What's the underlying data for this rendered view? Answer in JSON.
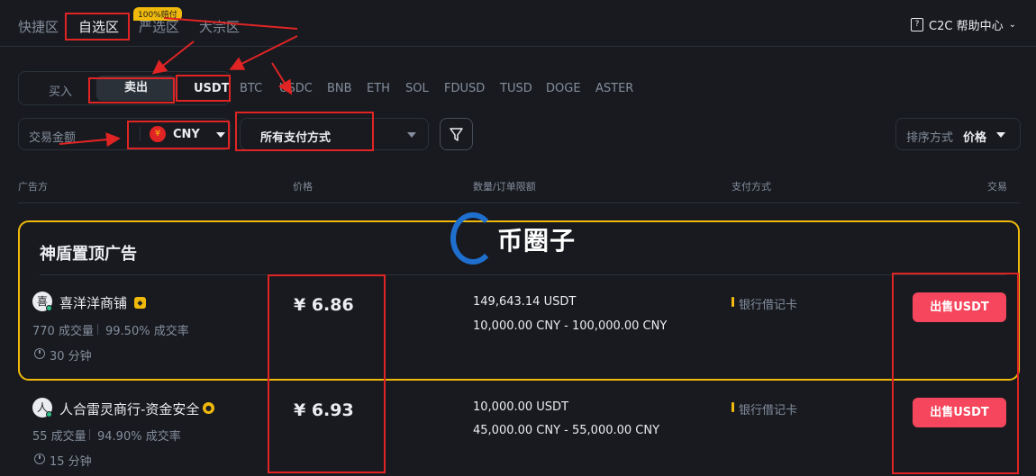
{
  "topbar": {
    "tabs": [
      "快捷区",
      "自选区",
      "严选区",
      "大宗区"
    ],
    "badge": "100%赔付",
    "help_label": "C2C 帮助中心"
  },
  "side_toggle": {
    "buy": "买入",
    "sell": "卖出"
  },
  "coins": [
    "USDT",
    "BTC",
    "USDC",
    "BNB",
    "ETH",
    "SOL",
    "FDUSD",
    "TUSD",
    "DOGE",
    "ASTER"
  ],
  "filters": {
    "amount_label": "交易金额",
    "currency_symbol": "¥",
    "currency": "CNY",
    "payment": "所有支付方式",
    "sort_label": "排序方式",
    "sort_value": "价格"
  },
  "table": {
    "headers": [
      "广告方",
      "价格",
      "数量/订单限额",
      "支付方式",
      "交易"
    ]
  },
  "promo": {
    "title": "神盾置顶广告"
  },
  "watermark": {
    "text": "币圈子"
  },
  "ads": [
    {
      "avatar": "喜",
      "merchant": "喜洋洋商铺",
      "orders": "770 成交量",
      "rate": "99.50% 成交率",
      "time": "30 分钟",
      "price": "¥ 6.86",
      "qty": "149,643.14 USDT",
      "limit": "10,000.00 CNY - 100,000.00 CNY",
      "payment": "银行借记卡",
      "action": "出售USDT"
    },
    {
      "avatar": "人",
      "merchant": "人合雷灵商行-资金安全",
      "orders": "55 成交量",
      "rate": "94.90% 成交率",
      "time": "15 分钟",
      "price": "¥ 6.93",
      "qty": "10,000.00 USDT",
      "limit": "45,000.00 CNY - 55,000.00 CNY",
      "payment": "银行借记卡",
      "action": "出售USDT"
    }
  ],
  "colors": {
    "background": "#181a20",
    "accent_yellow": "#f0b90b",
    "sell_red": "#f6465d",
    "annotation_red": "#e02424"
  }
}
